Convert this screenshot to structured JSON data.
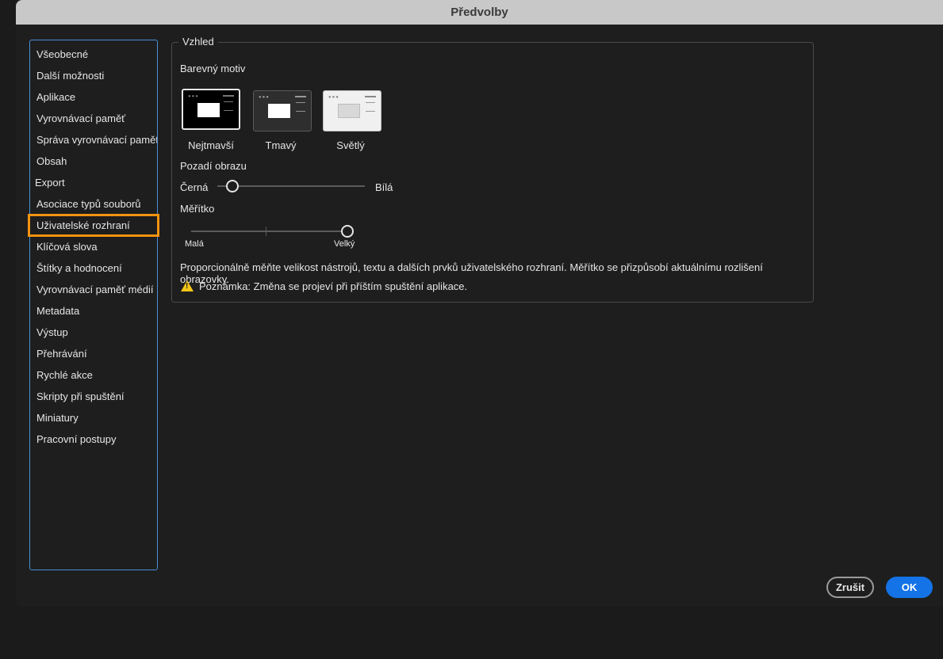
{
  "window": {
    "title": "Předvolby"
  },
  "sidebar": {
    "items": [
      {
        "label": "Všeobecné"
      },
      {
        "label": "Další možnosti"
      },
      {
        "label": "Aplikace"
      },
      {
        "label": "Vyrovnávací paměť"
      },
      {
        "label": "Správa vyrovnávací paměti"
      },
      {
        "label": "Obsah"
      },
      {
        "label": "Export"
      },
      {
        "label": "Asociace typů souborů"
      },
      {
        "label": "Uživatelské rozhraní"
      },
      {
        "label": "Klíčová slova"
      },
      {
        "label": "Štítky a hodnocení"
      },
      {
        "label": "Vyrovnávací paměť médií"
      },
      {
        "label": "Metadata"
      },
      {
        "label": "Výstup"
      },
      {
        "label": "Přehrávání"
      },
      {
        "label": "Rychlé akce"
      },
      {
        "label": "Skripty při spuštění"
      },
      {
        "label": "Miniatury"
      },
      {
        "label": "Pracovní postupy"
      }
    ],
    "selected": "Uživatelské rozhraní"
  },
  "appearance": {
    "legend": "Vzhled",
    "color_theme_label": "Barevný motiv",
    "themes": [
      {
        "label": "Nejtmavší",
        "selected": true
      },
      {
        "label": "Tmavý",
        "selected": false
      },
      {
        "label": "Světlý",
        "selected": false
      }
    ],
    "image_background": {
      "label": "Pozadí obrazu",
      "min_label": "Černá",
      "max_label": "Bílá",
      "value_fraction": 0.1
    },
    "scale": {
      "label": "Měřítko",
      "min_label": "Malá",
      "max_label": "Velký",
      "value_fraction": 1.0
    },
    "description": "Proporcionálně měňte velikost nástrojů, textu a dalších prvků uživatelského rozhraní. Měřítko se přizpůsobí aktuálnímu rozlišení obrazovky.",
    "note": "Poznámka: Změna se projeví při příštím spuštění aplikace."
  },
  "buttons": {
    "cancel": "Zrušit",
    "ok": "OK"
  },
  "colors": {
    "accent": "#1473e6",
    "highlight": "#f29310",
    "sidebar_border": "#4a90d9",
    "warning": "#f5c518"
  }
}
